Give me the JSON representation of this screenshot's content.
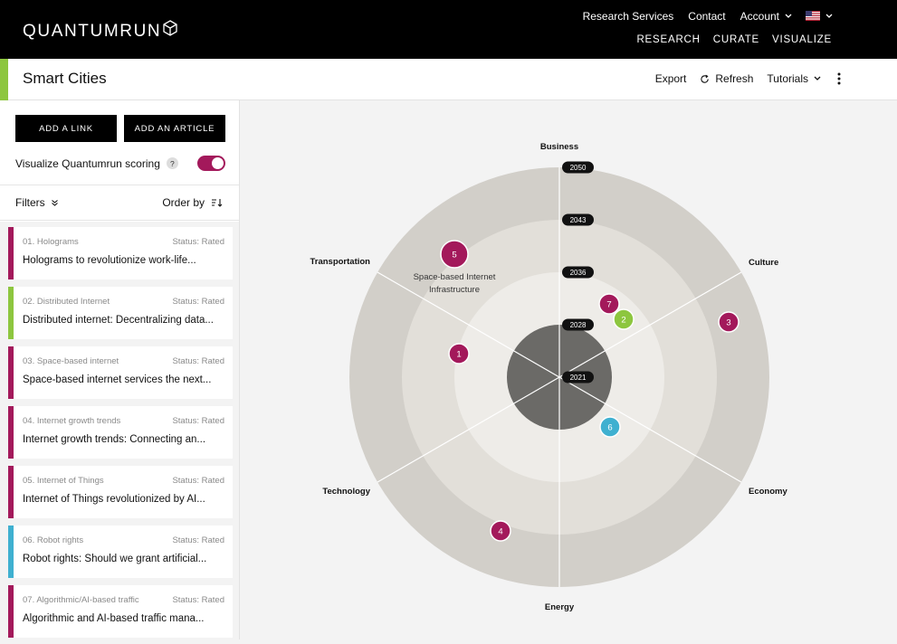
{
  "brand": {
    "name": "QUANTUMRUN"
  },
  "nav": {
    "top": [
      "Research Services",
      "Contact",
      "Account"
    ],
    "main": [
      "RESEARCH",
      "CURATE",
      "VISUALIZE"
    ],
    "flag": "us-flag-icon"
  },
  "page": {
    "title": "Smart Cities",
    "actions": {
      "export": "Export",
      "refresh": "Refresh",
      "tutorials": "Tutorials"
    }
  },
  "sidebar": {
    "add_link": "ADD A LINK",
    "add_article": "ADD AN ARTICLE",
    "viz_label": "Visualize Quantumrun scoring",
    "help": "?",
    "viz_toggle_on": true,
    "filters": "Filters",
    "order_by": "Order by",
    "items": [
      {
        "sub": "01. Holograms",
        "status": "Status: Rated",
        "title": "Holograms to revolutionize work-life...",
        "color": "#a3195b"
      },
      {
        "sub": "02. Distributed Internet",
        "status": "Status: Rated",
        "title": "Distributed internet: Decentralizing data...",
        "color": "#8dc63f"
      },
      {
        "sub": "03. Space-based internet",
        "status": "Status: Rated",
        "title": "Space-based internet services the next...",
        "color": "#a3195b"
      },
      {
        "sub": "04. Internet growth trends",
        "status": "Status: Rated",
        "title": "Internet growth trends: Connecting an...",
        "color": "#a3195b"
      },
      {
        "sub": "05. Internet of Things",
        "status": "Status: Rated",
        "title": "Internet of Things revolutionized by AI...",
        "color": "#a3195b"
      },
      {
        "sub": "06. Robot rights",
        "status": "Status: Rated",
        "title": "Robot rights: Should we grant artificial...",
        "color": "#3fb0d0"
      },
      {
        "sub": "07. Algorithmic/AI-based traffic",
        "status": "Status: Rated",
        "title": "Algorithmic and AI-based traffic mana...",
        "color": "#a3195b"
      }
    ]
  },
  "radar": {
    "sectors": [
      "Business",
      "Culture",
      "Economy",
      "Energy",
      "Technology",
      "Transportation"
    ],
    "rings": [
      "2021",
      "2028",
      "2036",
      "2043",
      "2050"
    ],
    "ring_colors": [
      "#d2cfc9",
      "#e2dfd9",
      "#eeece8",
      "#6b6a67"
    ],
    "points": [
      {
        "id": "1",
        "color": "#a3195b",
        "sector": "Transportation",
        "year": 2036
      },
      {
        "id": "2",
        "color": "#8dc63f",
        "sector": "Culture",
        "year": 2028
      },
      {
        "id": "3",
        "color": "#a3195b",
        "sector": "Culture",
        "year": 2043
      },
      {
        "id": "4",
        "color": "#a3195b",
        "sector": "Technology",
        "year": 2050
      },
      {
        "id": "5",
        "color": "#a3195b",
        "sector": "Transportation",
        "year": 2043,
        "label": [
          "Space-based Internet",
          "Infrastructure"
        ]
      },
      {
        "id": "6",
        "color": "#3fb0d0",
        "sector": "Economy",
        "year": 2028
      },
      {
        "id": "7",
        "color": "#a3195b",
        "sector": "Culture",
        "year": 2036
      }
    ]
  }
}
